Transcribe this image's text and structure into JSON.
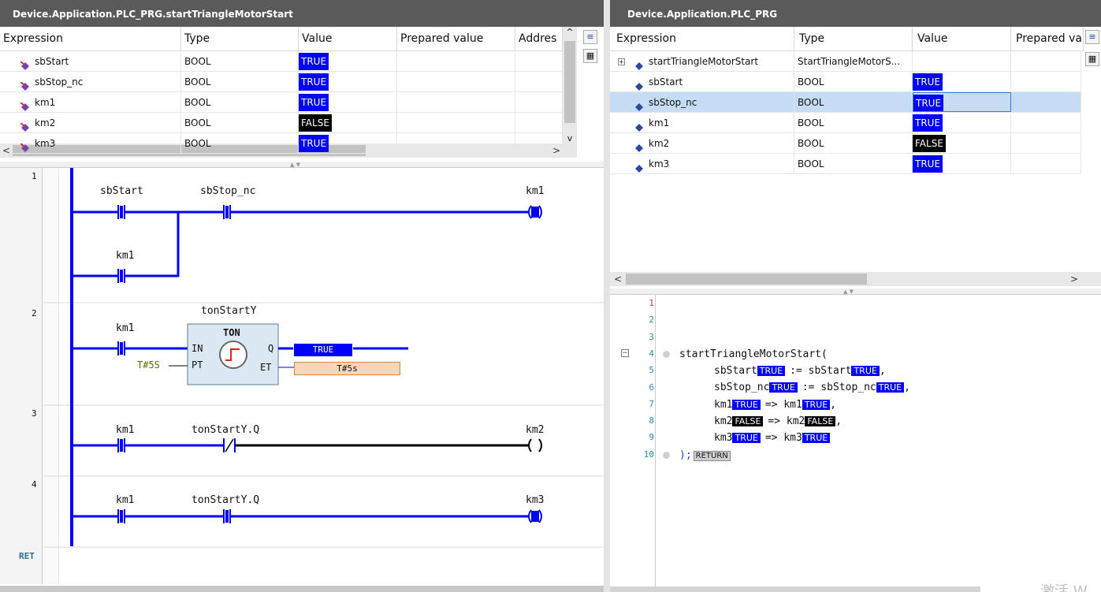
{
  "left_watch": {
    "title": "Device.Application.PLC_PRG.startTriangleMotorStart",
    "columns": [
      "Expression",
      "Type",
      "Value",
      "Prepared value",
      "Addres"
    ],
    "rows": [
      {
        "name": "sbStart",
        "type": "BOOL",
        "value": "TRUE"
      },
      {
        "name": "sbStop_nc",
        "type": "BOOL",
        "value": "TRUE"
      },
      {
        "name": "km1",
        "type": "BOOL",
        "value": "TRUE"
      },
      {
        "name": "km2",
        "type": "BOOL",
        "value": "FALSE"
      },
      {
        "name": "km3",
        "type": "BOOL",
        "value": "TRUE"
      }
    ]
  },
  "right_watch": {
    "title": "Device.Application.PLC_PRG",
    "columns": [
      "Expression",
      "Type",
      "Value",
      "Prepared va"
    ],
    "rows": [
      {
        "name": "startTriangleMotorStart",
        "type": "StartTriangleMotorS...",
        "value": ""
      },
      {
        "name": "sbStart",
        "type": "BOOL",
        "value": "TRUE"
      },
      {
        "name": "sbStop_nc",
        "type": "BOOL",
        "value": "TRUE"
      },
      {
        "name": "km1",
        "type": "BOOL",
        "value": "TRUE"
      },
      {
        "name": "km2",
        "type": "BOOL",
        "value": "FALSE"
      },
      {
        "name": "km3",
        "type": "BOOL",
        "value": "TRUE"
      }
    ]
  },
  "ladder": {
    "networks": [
      "1",
      "2",
      "3",
      "4",
      "RET"
    ],
    "n1": {
      "contact1": "sbStart",
      "contact2": "sbStop_nc",
      "coil": "km1",
      "branch": "km1"
    },
    "n2": {
      "contact": "km1",
      "instance": "tonStartY",
      "fb_type": "TON",
      "in": "IN",
      "pt": "PT",
      "q": "Q",
      "et": "ET",
      "pt_value": "T#5S",
      "q_value": "TRUE",
      "et_value": "T#5s"
    },
    "n3": {
      "contact1": "km1",
      "contact2": "tonStartY.Q",
      "coil": "km2"
    },
    "n4": {
      "contact1": "km1",
      "contact2": "tonStartY.Q",
      "coil": "km3"
    }
  },
  "code": {
    "line_numbers": [
      "1",
      "2",
      "3",
      "4",
      "5",
      "6",
      "7",
      "8",
      "9",
      "10"
    ],
    "call": "startTriangleMotorStart(",
    "params": [
      {
        "name": "sbStart",
        "v1": "TRUE",
        "op": ":= sbStart",
        "v2": "TRUE",
        "tail": ",",
        "f1": false,
        "f2": false
      },
      {
        "name": "sbStop_nc",
        "v1": "TRUE",
        "op": ":= sbStop_nc",
        "v2": "TRUE",
        "tail": ",",
        "f1": false,
        "f2": false
      },
      {
        "name": "km1",
        "v1": "TRUE",
        "op": "=> km1",
        "v2": "TRUE",
        "tail": ",",
        "f1": false,
        "f2": false
      },
      {
        "name": "km2",
        "v1": "FALSE",
        "op": "=> km2",
        "v2": "FALSE",
        "tail": ",",
        "f1": true,
        "f2": true
      },
      {
        "name": "km3",
        "v1": "TRUE",
        "op": "=> km3",
        "v2": "TRUE",
        "tail": "",
        "f1": false,
        "f2": false
      }
    ],
    "close": ");",
    "return_label": "RETURN"
  },
  "watermark": "激活 W",
  "colors": {
    "true": "#0000ff",
    "false": "#000000",
    "wire": "#0000ff",
    "selected_row": "#c5dcf5"
  }
}
